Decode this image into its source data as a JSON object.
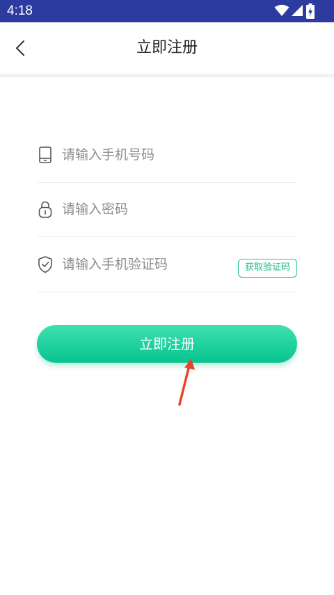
{
  "status_bar": {
    "time": "4:18",
    "icons": [
      "wifi-icon",
      "signal-icon",
      "battery-charging-icon"
    ],
    "background_color": "#2d3aa0"
  },
  "header": {
    "title": "立即注册",
    "back_icon": "chevron-left-icon"
  },
  "form": {
    "phone": {
      "icon": "phone-icon",
      "placeholder": "请输入手机号码",
      "value": ""
    },
    "password": {
      "icon": "lock-icon",
      "placeholder": "请输入密码",
      "value": ""
    },
    "code": {
      "icon": "shield-check-icon",
      "placeholder": "请输入手机验证码",
      "value": "",
      "get_code_label": "获取验证码"
    }
  },
  "submit_label": "立即注册",
  "colors": {
    "accent": "#1fc597",
    "button_gradient_top": "#3fe0ae",
    "button_gradient_bottom": "#07c491",
    "annotation_arrow": "#e8432b"
  }
}
